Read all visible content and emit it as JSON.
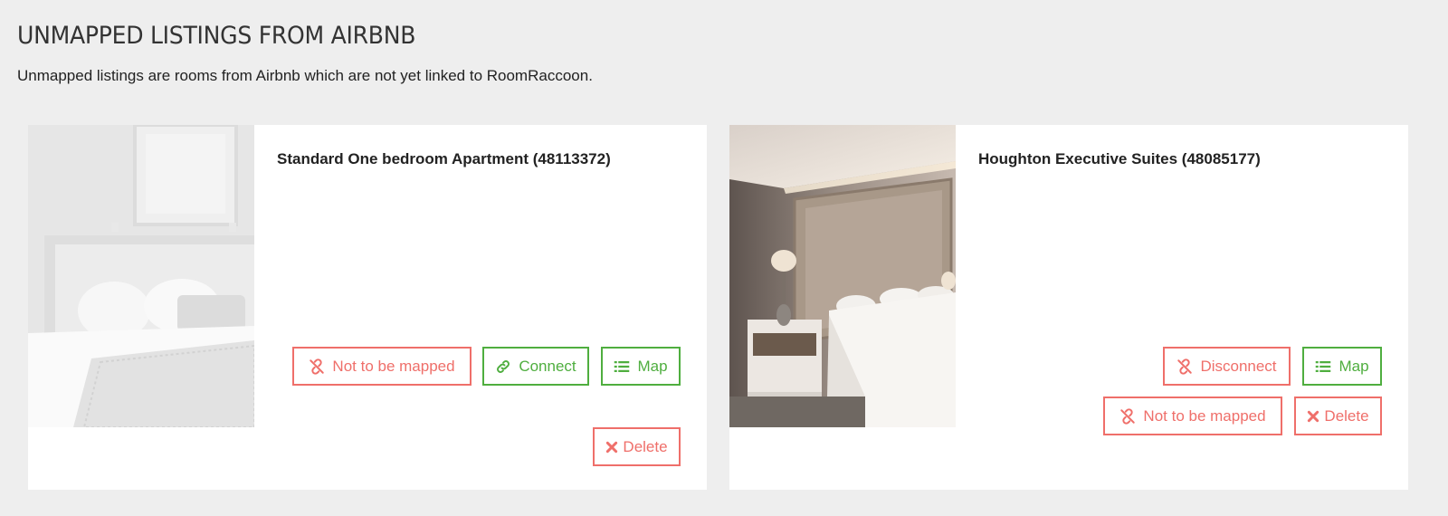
{
  "page": {
    "title": "UNMAPPED LISTINGS FROM AIRBNB",
    "description": "Unmapped listings are rooms from Airbnb which are not yet linked to RoomRaccoon."
  },
  "listings": [
    {
      "title": "Standard One bedroom Apartment (48113372)",
      "image": "bedroom-photo-greyscale",
      "buttons": {
        "not_mapped": "Not to be mapped",
        "connect": "Connect",
        "map": "Map",
        "delete": "Delete"
      }
    },
    {
      "title": "Houghton Executive Suites (48085177)",
      "image": "bedroom-photo-color",
      "buttons": {
        "disconnect": "Disconnect",
        "map": "Map",
        "not_mapped": "Not to be mapped",
        "delete": "Delete"
      }
    }
  ],
  "icons": {
    "unlink": "unlink-icon",
    "link": "link-icon",
    "list": "list-icon",
    "close": "close-icon"
  },
  "colors": {
    "danger": "#ef6f6a",
    "success": "#4fae3f",
    "background": "#eeeeee"
  }
}
